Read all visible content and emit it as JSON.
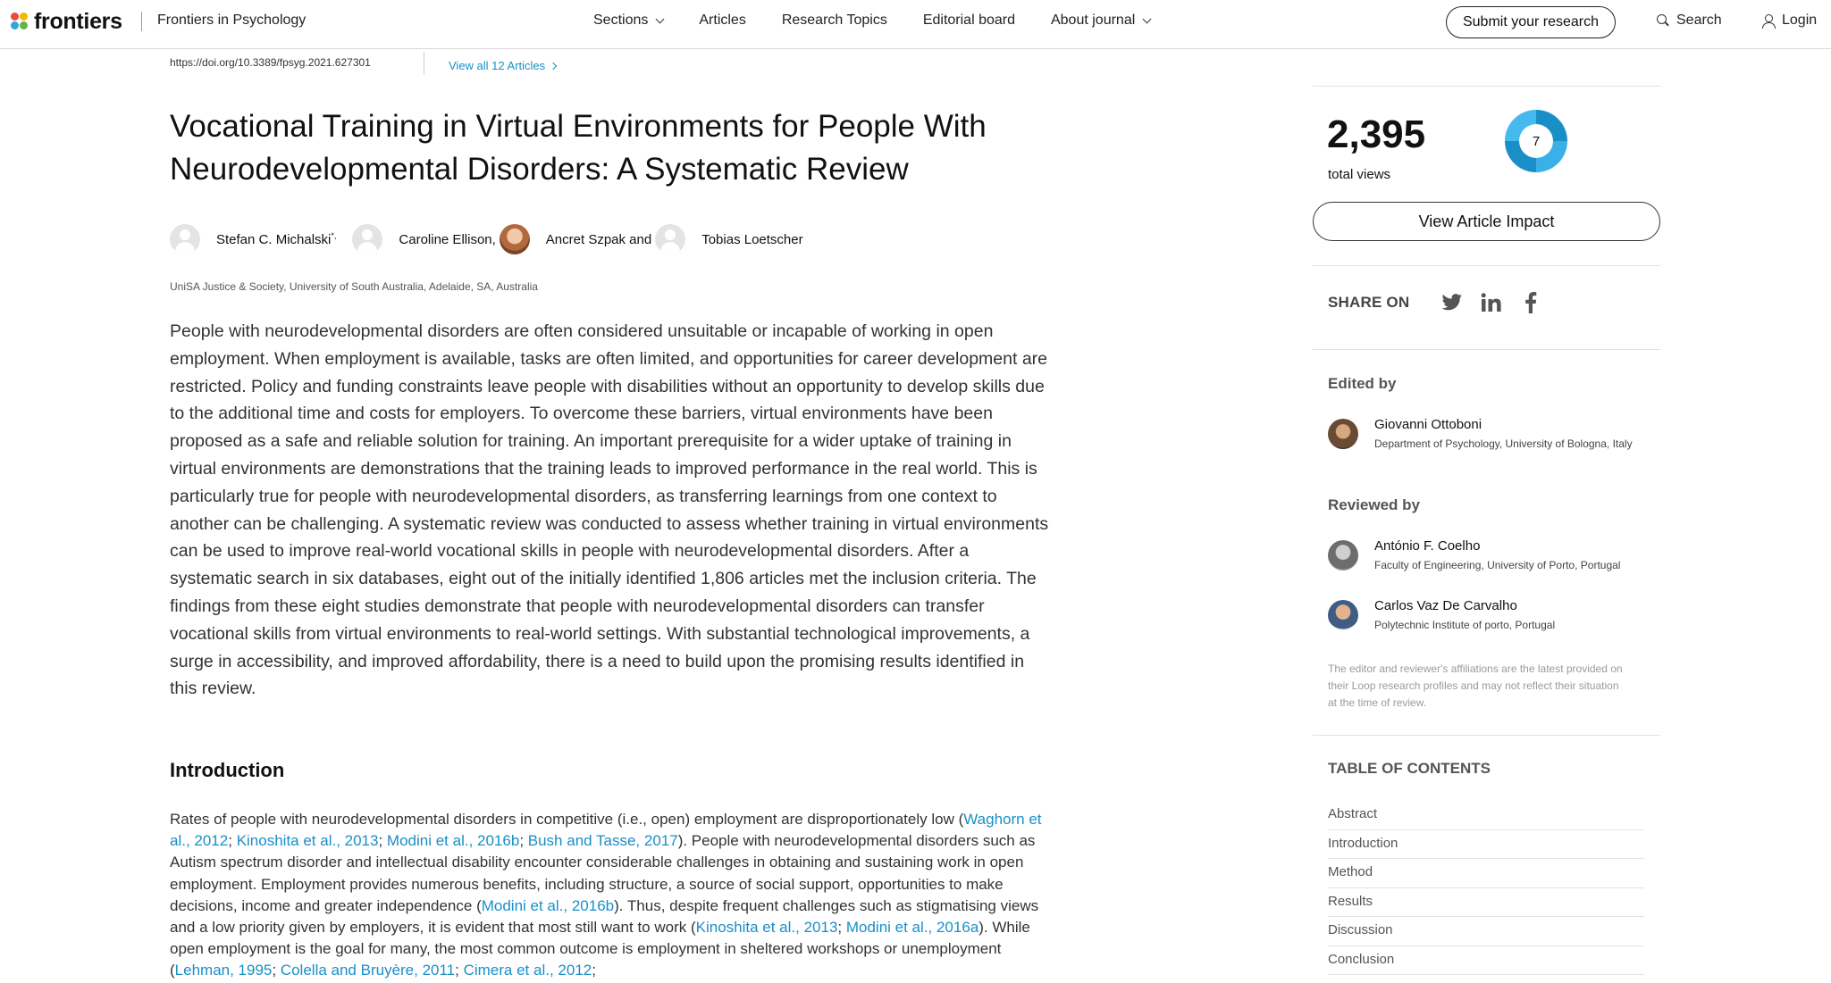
{
  "header": {
    "logo_text": "frontiers",
    "journal": "Frontiers in Psychology",
    "nav": [
      {
        "label": "Sections",
        "dropdown": true
      },
      {
        "label": "Articles",
        "dropdown": false
      },
      {
        "label": "Research Topics",
        "dropdown": false
      },
      {
        "label": "Editorial board",
        "dropdown": false
      },
      {
        "label": "About journal",
        "dropdown": true
      }
    ],
    "submit_label": "Submit your research",
    "search_label": "Search",
    "login_label": "Login"
  },
  "article": {
    "doi": "https://doi.org/10.3389/fpsyg.2021.627301",
    "view_all": "View all 12 Articles",
    "title": "Vocational Training in Virtual Environments for People With Neurodevelopmental Disorders: A Systematic Review",
    "authors": [
      {
        "name": "Stefan C. Michalski",
        "suffix": "*,",
        "photo": false
      },
      {
        "name": "Caroline Ellison,",
        "suffix": "",
        "photo": false
      },
      {
        "name": "Ancret Szpak and",
        "suffix": "",
        "photo": true
      },
      {
        "name": "Tobias Loetscher",
        "suffix": "",
        "photo": false
      }
    ],
    "affiliation": "UniSA Justice & Society, University of South Australia, Adelaide, SA, Australia",
    "abstract": "People with neurodevelopmental disorders are often considered unsuitable or incapable of working in open employment. When employment is available, tasks are often limited, and opportunities for career development are restricted. Policy and funding constraints leave people with disabilities without an opportunity to develop skills due to the additional time and costs for employers. To overcome these barriers, virtual environments have been proposed as a safe and reliable solution for training. An important prerequisite for a wider uptake of training in virtual environments are demonstrations that the training leads to improved performance in the real world. This is particularly true for people with neurodevelopmental disorders, as transferring learnings from one context to another can be challenging. A systematic review was conducted to assess whether training in virtual environments can be used to improve real-world vocational skills in people with neurodevelopmental disorders. After a systematic search in six databases, eight out of the initially identified 1,806 articles met the inclusion criteria. The findings from these eight studies demonstrate that people with neurodevelopmental disorders can transfer vocational skills from virtual environments to real-world settings. With substantial technological improvements, a surge in accessibility, and improved affordability, there is a need to build upon the promising results identified in this review.",
    "intro_heading": "Introduction",
    "intro": {
      "t1": "Rates of people with neurodevelopmental disorders in competitive (i.e., open) employment are disproportionately low (",
      "c1": "Waghorn et al., 2012",
      "s1": "; ",
      "c2": "Kinoshita et al., 2013",
      "s2": "; ",
      "c3": "Modini et al., 2016b",
      "s3": "; ",
      "c4": "Bush and Tasse, 2017",
      "t2": "). People with neurodevelopmental disorders such as Autism spectrum disorder and intellectual disability encounter considerable challenges in obtaining and sustaining work in open employment. Employment provides numerous benefits, including structure, a source of social support, opportunities to make decisions, income and greater independence (",
      "c5": "Modini et al., 2016b",
      "t3": "). Thus, despite frequent challenges such as stigmatising views and a low priority given by employers, it is evident that most still want to work (",
      "c6": "Kinoshita et al., 2013",
      "s4": "; ",
      "c7": "Modini et al., 2016a",
      "t4": "). While open employment is the goal for many, the most common outcome is employment in sheltered workshops or unemployment (",
      "c8": "Lehman, 1995",
      "s5": "; ",
      "c9": "Colella and Bruyère, 2011",
      "s6": "; ",
      "c10": "Cimera et al., 2012",
      "t5": ";"
    }
  },
  "sidebar": {
    "views": "2,395",
    "views_label": "total views",
    "donut_value": "7",
    "impact_button": "View Article Impact",
    "share_label": "SHARE ON",
    "share_icons": [
      "twitter-icon",
      "linkedin-icon",
      "facebook-icon"
    ],
    "edited_by": "Edited by",
    "editor": {
      "name": "Giovanni Ottoboni",
      "affiliation": "Department of Psychology, University of Bologna, Italy"
    },
    "reviewed_by": "Reviewed by",
    "reviewers": [
      {
        "name": "António F. Coelho",
        "affiliation": "Faculty of Engineering, University of Porto, Portugal"
      },
      {
        "name": "Carlos Vaz De Carvalho",
        "affiliation": "Polytechnic Institute of porto, Portugal"
      }
    ],
    "disclaimer": "The editor and reviewer's affiliations are the latest provided on their Loop research profiles and may not reflect their situation at the time of review.",
    "toc_heading": "TABLE OF CONTENTS",
    "toc": [
      "Abstract",
      "Introduction",
      "Method",
      "Results",
      "Discussion",
      "Conclusion"
    ]
  },
  "colors": {
    "link": "#1a8fc7",
    "text": "#111111",
    "muted": "#9a9a9a"
  }
}
